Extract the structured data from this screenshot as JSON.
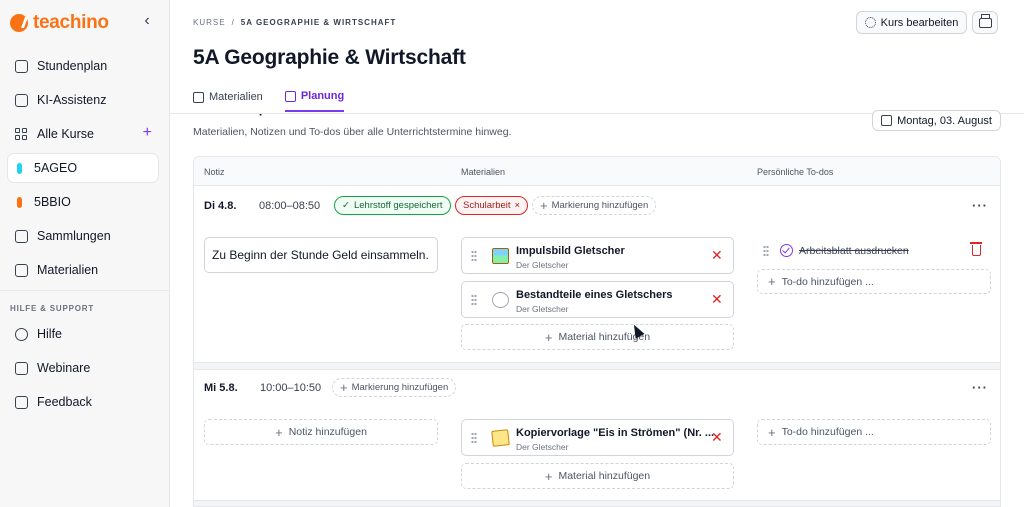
{
  "app": {
    "name": "teachino"
  },
  "sidebar": {
    "items": [
      {
        "label": "Stundenplan"
      },
      {
        "label": "KI-Assistenz"
      },
      {
        "label": "Alle Kurse"
      },
      {
        "label": "5AGEO",
        "color": "#22d3ee"
      },
      {
        "label": "5BBIO",
        "color": "#f97316"
      },
      {
        "label": "Sammlungen"
      },
      {
        "label": "Materialien"
      }
    ],
    "support_title": "HILFE & SUPPORT",
    "support_items": [
      {
        "label": "Hilfe"
      },
      {
        "label": "Webinare"
      },
      {
        "label": "Feedback"
      }
    ]
  },
  "header": {
    "breadcrumb_root": "KURSE",
    "breadcrumb_sep": "/",
    "breadcrumb_current": "5A GEOGRAPHIE & WIRTSCHAFT",
    "edit_label": "Kurs bearbeiten",
    "title": "5A Geographie & Wirtschaft",
    "tabs": [
      {
        "label": "Materialien"
      },
      {
        "label": "Planung",
        "active": true
      }
    ]
  },
  "planning": {
    "section_title": "Unterricht planen",
    "description": "Materialien, Notizen und To-dos über alle Unterrichtstermine hinweg.",
    "date_label": "Montag, 03. August",
    "columns": [
      "Notiz",
      "Materialien",
      "Persönliche To-dos"
    ],
    "rows": [
      {
        "day": "Di 4.8.",
        "time": "08:00–08:50",
        "tags": [
          "Lehrstoff gespeichert",
          "Schularbeit"
        ],
        "add_tag_label": "Markierung hinzufügen",
        "note": "Zu Beginn der Stunde Geld einsammeln.",
        "materials": [
          {
            "title": "Impulsbild Gletscher",
            "subtitle": "Der Gletscher"
          },
          {
            "title": "Bestandteile eines Gletschers",
            "subtitle": "Der Gletscher"
          }
        ],
        "add_material_label": "Material hinzufügen",
        "todos": [
          {
            "text": "Arbeitsblatt ausdrucken",
            "done": true
          }
        ],
        "add_todo_label": "To-do hinzufügen ..."
      },
      {
        "day": "Mi 5.8.",
        "time": "10:00–10:50",
        "add_tag_label": "Markierung hinzufügen",
        "add_note_label": "Notiz hinzufügen",
        "materials": [
          {
            "title": "Kopiervorlage \"Eis in Strömen\" (Nr. ...",
            "subtitle": "Der Gletscher"
          }
        ],
        "add_material_label": "Material hinzufügen",
        "add_todo_label": "To-do hinzufügen ..."
      }
    ]
  },
  "colors": {
    "accent": "#7c3aed",
    "brand": "#f97316",
    "danger": "#dc2626",
    "success": "#16a34a"
  }
}
